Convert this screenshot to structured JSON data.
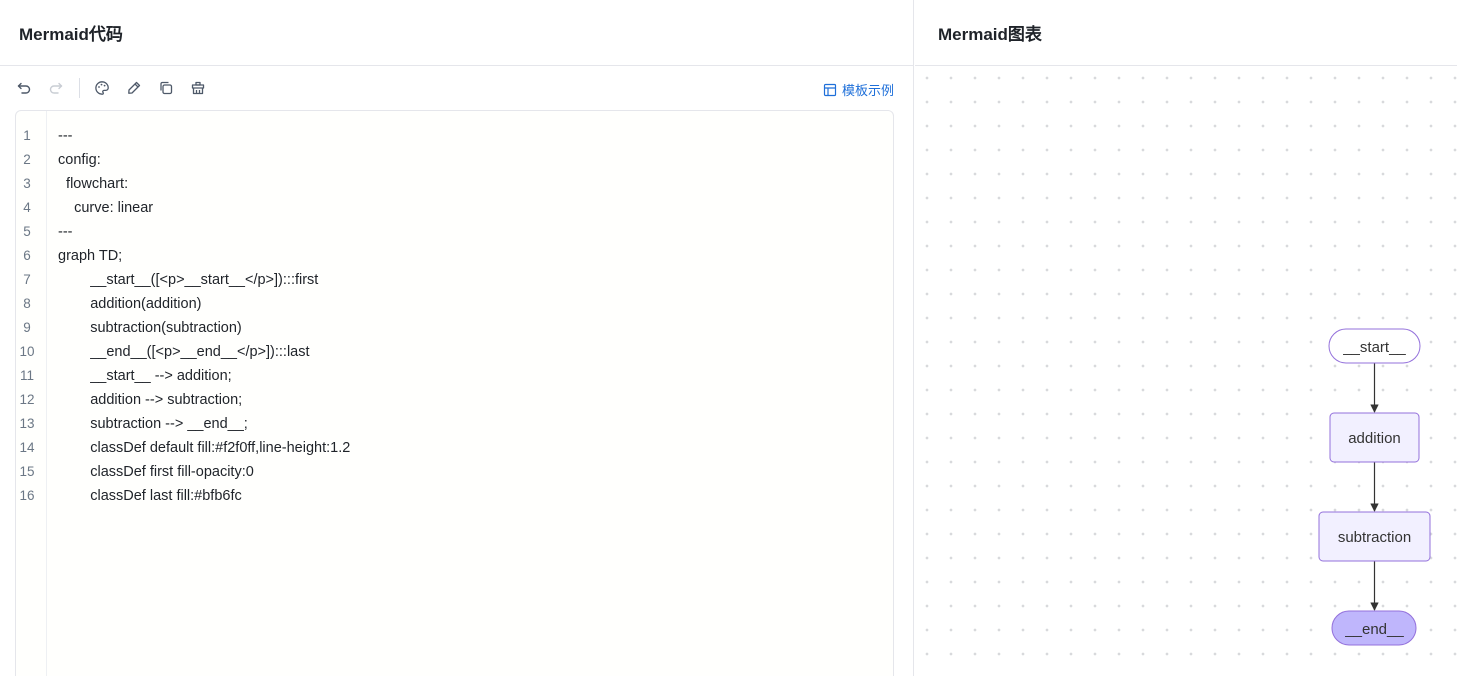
{
  "left_panel": {
    "title": "Mermaid代码"
  },
  "toolbar": {
    "icons": [
      "undo-icon",
      "redo-icon",
      "palette-icon",
      "pen-icon",
      "copy-icon",
      "clear-icon"
    ],
    "template_label": "模板示例"
  },
  "editor": {
    "lines": [
      {
        "n": "1",
        "code": "---"
      },
      {
        "n": "2",
        "code": "config:"
      },
      {
        "n": "3",
        "code": "  flowchart:"
      },
      {
        "n": "4",
        "code": "    curve: linear"
      },
      {
        "n": "5",
        "code": "---"
      },
      {
        "n": "6",
        "code": "graph TD;"
      },
      {
        "n": "7",
        "code": "        __start__([<p>__start__</p>]):::first"
      },
      {
        "n": "8",
        "code": "        addition(addition)"
      },
      {
        "n": "9",
        "code": "        subtraction(subtraction)"
      },
      {
        "n": "10",
        "code": "        __end__([<p>__end__</p>]):::last"
      },
      {
        "n": "11",
        "code": "        __start__ --> addition;"
      },
      {
        "n": "12",
        "code": "        addition --> subtraction;"
      },
      {
        "n": "13",
        "code": "        subtraction --> __end__;"
      },
      {
        "n": "14",
        "code": "        classDef default fill:#f2f0ff,line-height:1.2"
      },
      {
        "n": "15",
        "code": "        classDef first fill-opacity:0"
      },
      {
        "n": "16",
        "code": "        classDef last fill:#bfb6fc"
      }
    ]
  },
  "right_panel": {
    "title": "Mermaid图表"
  },
  "diagram": {
    "nodes": [
      {
        "id": "start",
        "label": "__start__",
        "shape": "stadium",
        "fill": "#ffffff",
        "stroke": "#9370db"
      },
      {
        "id": "addition",
        "label": "addition",
        "shape": "rounded",
        "fill": "#f2f0ff",
        "stroke": "#9370db"
      },
      {
        "id": "subtraction",
        "label": "subtraction",
        "shape": "rounded",
        "fill": "#f2f0ff",
        "stroke": "#9370db"
      },
      {
        "id": "end",
        "label": "__end__",
        "shape": "stadium",
        "fill": "#bfb6fc",
        "stroke": "#9370db"
      }
    ],
    "edges": [
      {
        "from": "start",
        "to": "addition"
      },
      {
        "from": "addition",
        "to": "subtraction"
      },
      {
        "from": "subtraction",
        "to": "end"
      }
    ]
  },
  "colors": {
    "accent": "#1e6fd9",
    "edge": "#333333"
  }
}
